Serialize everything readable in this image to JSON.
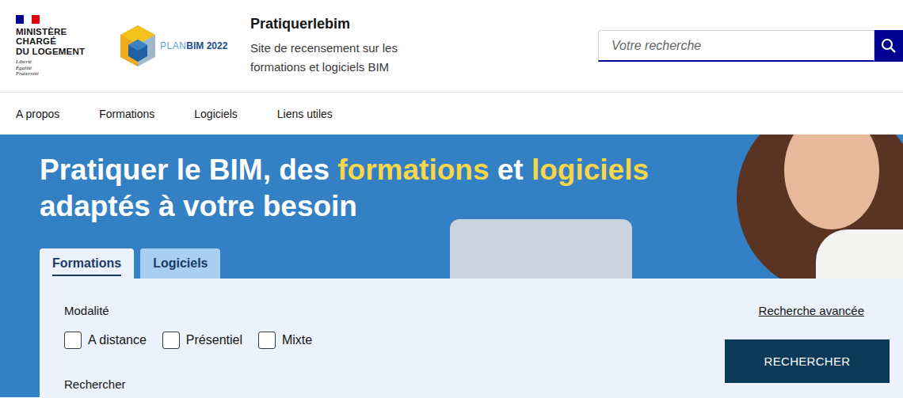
{
  "ministry": {
    "lines": [
      "MINISTÈRE",
      "CHARGÉ",
      "DU LOGEMENT"
    ],
    "motto": [
      "Liberté",
      "Égalité",
      "Fraternité"
    ]
  },
  "planbim": {
    "prefix": "PLAN",
    "name": "BIM 2022"
  },
  "site": {
    "title": "Pratiquerlebim",
    "subtitle": "Site de recensement sur les formations et logiciels BIM"
  },
  "search": {
    "placeholder": "Votre recherche"
  },
  "nav": [
    "A propos",
    "Formations",
    "Logiciels",
    "Liens utiles"
  ],
  "hero": {
    "lines": [
      [
        {
          "text": "Pratiquer le BIM, des ",
          "highlight": false
        },
        {
          "text": "formations",
          "highlight": true
        },
        {
          "text": " et ",
          "highlight": false
        },
        {
          "text": "logiciels",
          "highlight": true
        }
      ],
      [
        {
          "text": "adaptés à votre besoin",
          "highlight": false
        }
      ]
    ]
  },
  "tabs": [
    {
      "label": "Formations",
      "selected": true
    },
    {
      "label": "Logiciels",
      "selected": false
    }
  ],
  "form": {
    "modality_label": "Modalité",
    "options": [
      {
        "label": "A distance",
        "checked": false
      },
      {
        "label": "Présentiel",
        "checked": false
      },
      {
        "label": "Mixte",
        "checked": false
      }
    ],
    "advanced": "Recherche avancée",
    "submit": "RECHERCHER",
    "search_label": "Rechercher"
  }
}
